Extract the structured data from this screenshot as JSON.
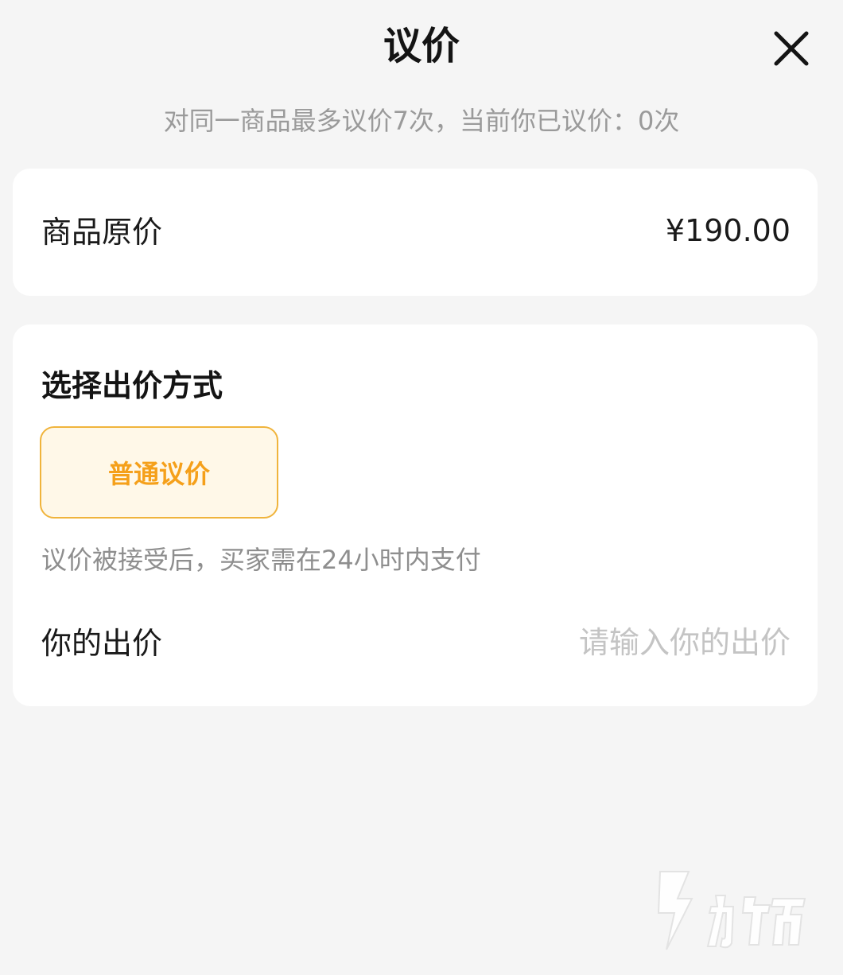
{
  "header": {
    "title": "议价"
  },
  "notice": "对同一商品最多议价7次，当前你已议价：0次",
  "price_card": {
    "label": "商品原价",
    "value": "¥190.00"
  },
  "offer_card": {
    "section_title": "选择出价方式",
    "methods": [
      {
        "label": "普通议价",
        "selected": true
      }
    ],
    "method_hint": "议价被接受后，买家需在24小时内支付",
    "bid_label": "你的出价",
    "bid_input": {
      "value": "",
      "placeholder": "请输入你的出价"
    }
  },
  "colors": {
    "background": "#f5f5f5",
    "card": "#ffffff",
    "accent": "#f5a01a",
    "accent_border": "#f0b43c",
    "accent_bg": "#fff8e8",
    "muted_text": "#9a9a9a",
    "placeholder": "#c4c4c4"
  },
  "icons": {
    "close": "close-icon",
    "watermark": "watermark-logo"
  }
}
